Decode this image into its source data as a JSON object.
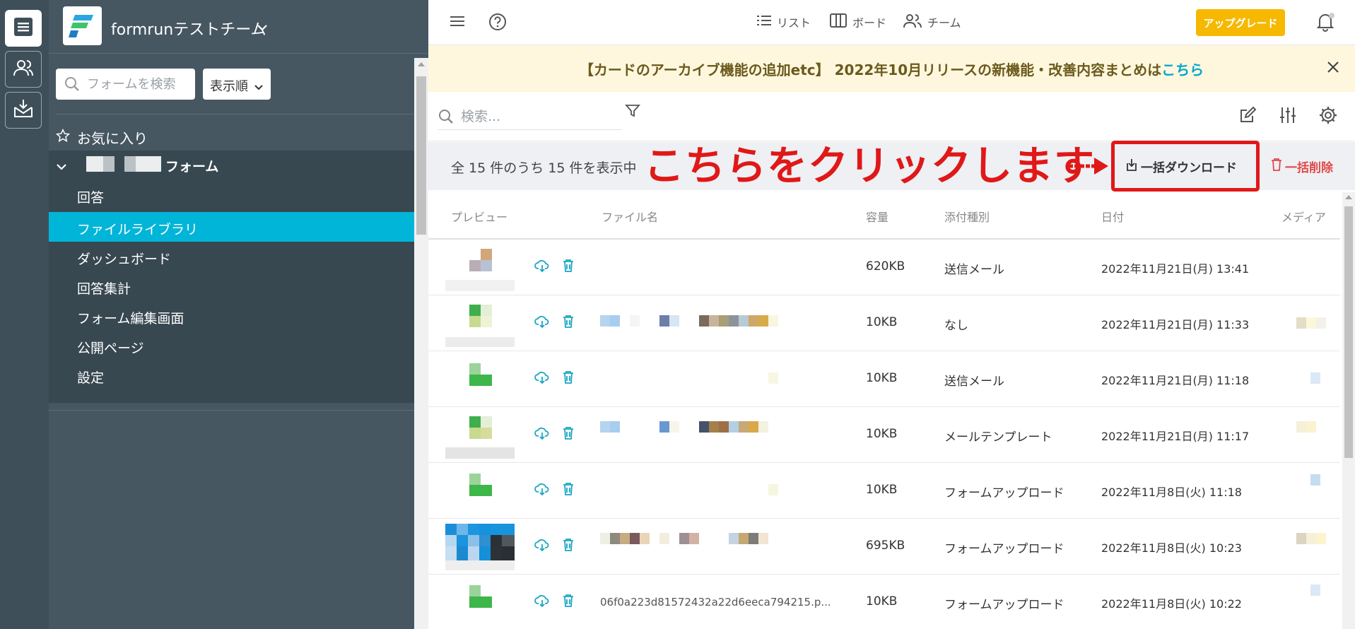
{
  "team": {
    "name": "formrunテストチーム"
  },
  "sidebar": {
    "search_placeholder": "フォームを検索",
    "sort_label": "表示順",
    "favorites_label": "お気に入り",
    "form_name": "フォーム",
    "items": [
      {
        "label": "回答"
      },
      {
        "label": "ファイルライブラリ",
        "active": true
      },
      {
        "label": "ダッシュボード"
      },
      {
        "label": "回答集計"
      },
      {
        "label": "フォーム編集画面"
      },
      {
        "label": "公開ページ"
      },
      {
        "label": "設定"
      }
    ]
  },
  "topbar": {
    "views": [
      {
        "label": "リスト",
        "icon": "list-icon"
      },
      {
        "label": "ボード",
        "icon": "board-icon"
      },
      {
        "label": "チーム",
        "icon": "team-icon"
      }
    ],
    "upgrade_label": "アップグレード"
  },
  "banner": {
    "text": "【カードのアーカイブ機能の追加etc】 2022年10月リリースの新機能・改善内容まとめは",
    "link": "こちら"
  },
  "toolbar": {
    "search_placeholder": "検索..."
  },
  "countbar": {
    "count_text": "全 15 件のうち 15 件を表示中",
    "annotation": "こちらをクリックします",
    "download_label": "一括ダウンロード",
    "delete_label": "一括削除"
  },
  "table": {
    "headers": {
      "preview": "プレビュー",
      "filename": "ファイル名",
      "size": "容量",
      "type": "添付種別",
      "date": "日付",
      "media": "メディア"
    },
    "rows": [
      {
        "size": "620KB",
        "type": "送信メール",
        "date": "2022年11月21日(月) 13:41",
        "filename": ""
      },
      {
        "size": "10KB",
        "type": "なし",
        "date": "2022年11月21日(月) 11:33",
        "filename": ""
      },
      {
        "size": "10KB",
        "type": "送信メール",
        "date": "2022年11月21日(月) 11:18",
        "filename": ""
      },
      {
        "size": "10KB",
        "type": "メールテンプレート",
        "date": "2022年11月21日(月) 11:17",
        "filename": ""
      },
      {
        "size": "10KB",
        "type": "フォームアップロード",
        "date": "2022年11月8日(火) 11:18",
        "filename": ""
      },
      {
        "size": "695KB",
        "type": "フォームアップロード",
        "date": "2022年11月8日(火) 10:23",
        "filename": ""
      },
      {
        "size": "10KB",
        "type": "フォームアップロード",
        "date": "2022年11月8日(火) 10:22",
        "filename": "06f0a223d81572432a22d6eeca794215.p..."
      }
    ]
  },
  "colors": {
    "sidebar_bg": "#465762",
    "active_item": "#00b5d8",
    "upgrade": "#f6b800",
    "annotation_red": "#e01818",
    "icon_teal": "#1aa6c4"
  }
}
